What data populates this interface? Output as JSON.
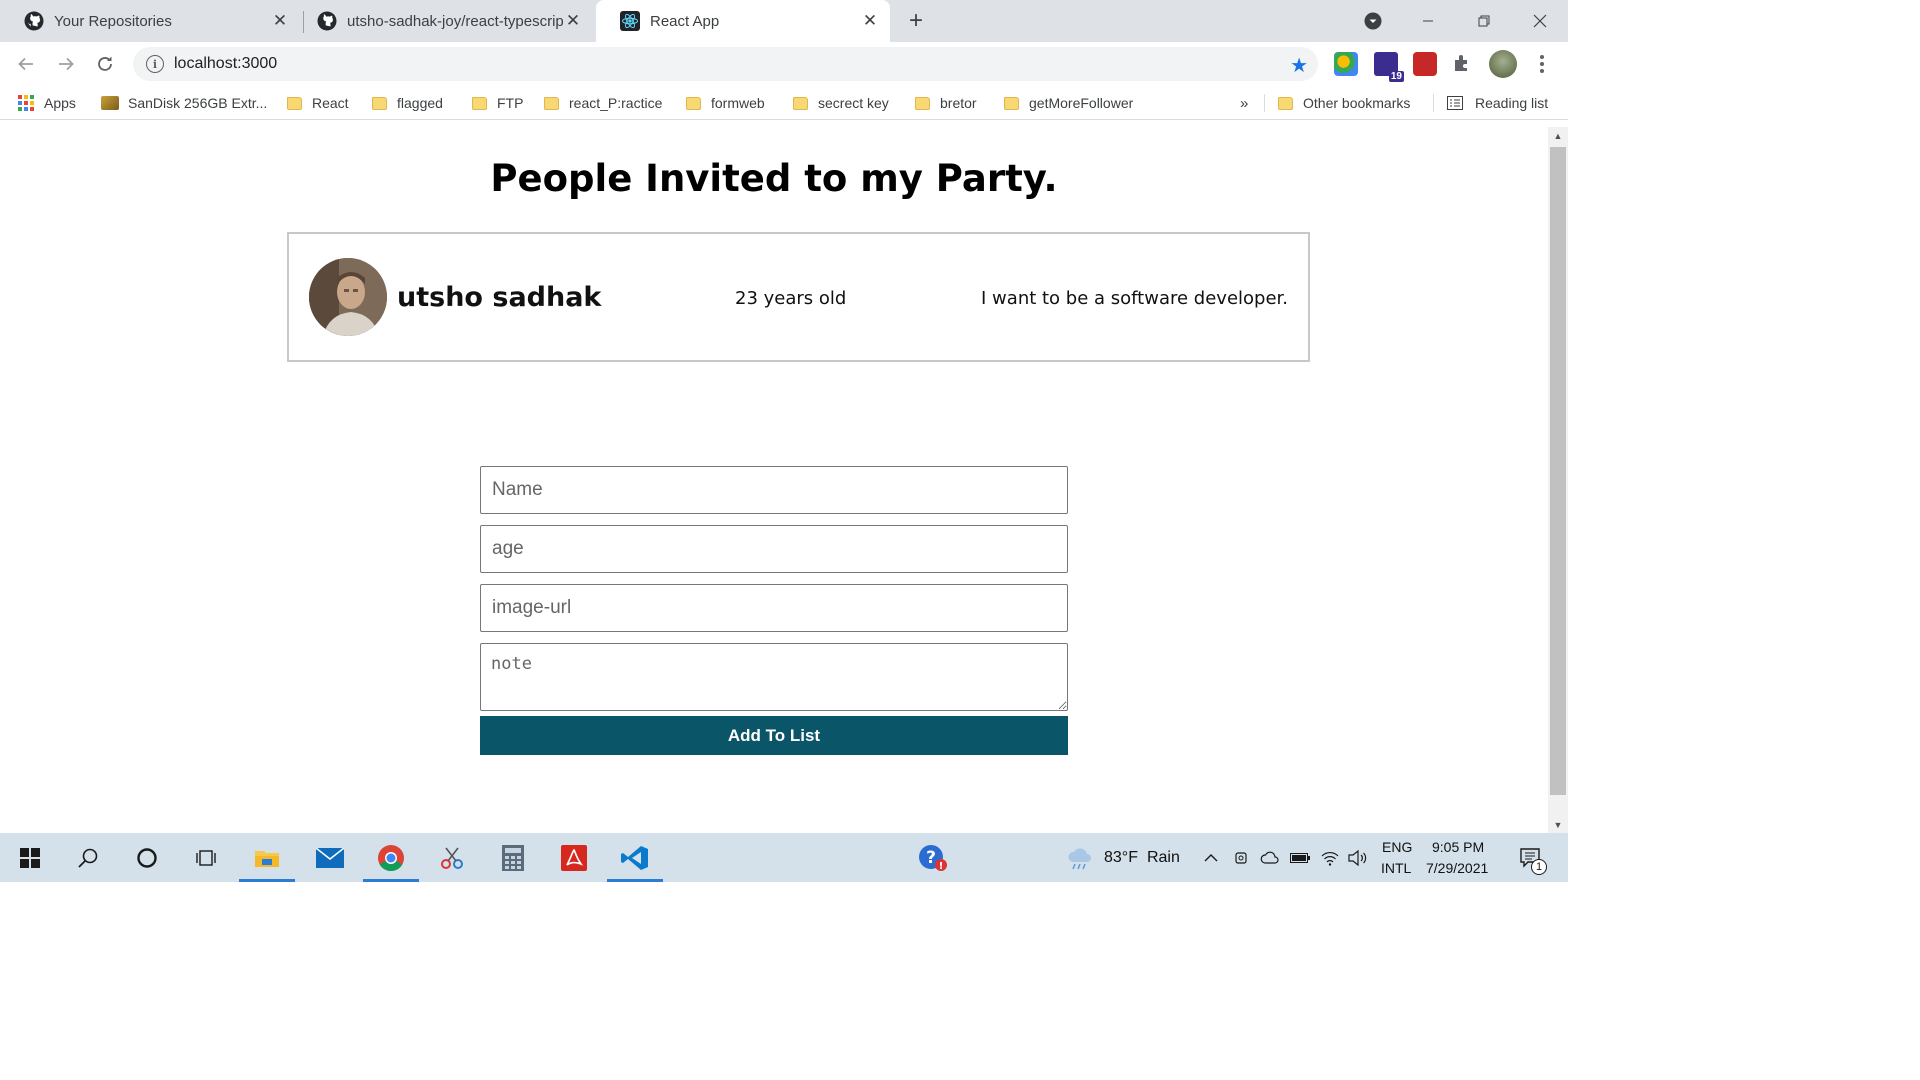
{
  "browser": {
    "tabs": [
      {
        "title": "Your Repositories",
        "icon": "github-icon",
        "active": false
      },
      {
        "title": "utsho-sadhak-joy/react-typescrip",
        "icon": "github-icon",
        "active": false
      },
      {
        "title": "React App",
        "icon": "react-icon",
        "active": true
      }
    ],
    "new_tab": "+",
    "url": "localhost:3000",
    "bookmarks": [
      {
        "label": "Apps",
        "icon": "apps-grid-icon"
      },
      {
        "label": "SanDisk 256GB Extr...",
        "icon": "sandisk-icon"
      },
      {
        "label": "React",
        "icon": "folder-icon"
      },
      {
        "label": "flagged",
        "icon": "folder-icon"
      },
      {
        "label": "FTP",
        "icon": "folder-icon"
      },
      {
        "label": "react_P:ractice",
        "icon": "folder-icon"
      },
      {
        "label": "formweb",
        "icon": "folder-icon"
      },
      {
        "label": "secrect key",
        "icon": "folder-icon"
      },
      {
        "label": "bretor",
        "icon": "folder-icon"
      },
      {
        "label": "getMoreFollower",
        "icon": "folder-icon"
      }
    ],
    "more_bookmarks": "»",
    "other_bookmarks": "Other bookmarks",
    "reading_list": "Reading list",
    "extension_badge": "19"
  },
  "page": {
    "heading": "People Invited to my Party.",
    "people": [
      {
        "name": "utsho sadhak",
        "age": "23 years old",
        "note": "I want to be a software developer."
      }
    ],
    "form": {
      "name_placeholder": "Name",
      "age_placeholder": "age",
      "image_placeholder": "image-url",
      "note_placeholder": "note",
      "submit_label": "Add To List"
    }
  },
  "taskbar": {
    "weather_temp": "83°F",
    "weather_desc": "Rain",
    "lang_top": "ENG",
    "lang_bottom": "INTL",
    "time": "9:05 PM",
    "date": "7/29/2021",
    "notification_count": "1"
  },
  "colors": {
    "button_bg": "#0b5568",
    "tabstrip_bg": "#dee1e6",
    "taskbar_bg": "#d4e1ea",
    "star": "#1a73e8"
  }
}
